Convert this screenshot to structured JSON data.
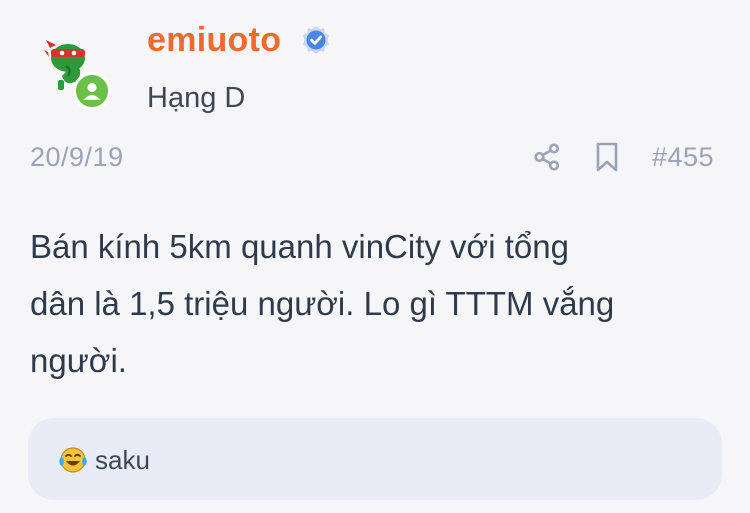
{
  "post": {
    "author": {
      "username": "emiuoto",
      "verified": true,
      "rank": "Hạng D",
      "avatar_icon": "ninja-turtle-avatar",
      "status_icon": "online-user-badge-icon"
    },
    "date": "20/9/19",
    "actions": {
      "share_icon": "share-icon",
      "bookmark_icon": "bookmark-icon"
    },
    "number": "#455",
    "content": "Bán kính 5km quanh vinCity với tổng\ndân là 1,5 triệu người. Lo gì TTTM vắng\nngười.",
    "reactions": {
      "emoji_icon": "laughing-tears-emoji-icon",
      "users": "saku"
    }
  },
  "colors": {
    "background": "#f6f6f8",
    "username": "#ee6a2f",
    "verified_badge": "#4a86e8",
    "online_badge": "#6cc04a",
    "meta_text": "#9aa3b8",
    "body_text": "#2f3a4d",
    "reaction_bar": "#e8ecf6"
  }
}
